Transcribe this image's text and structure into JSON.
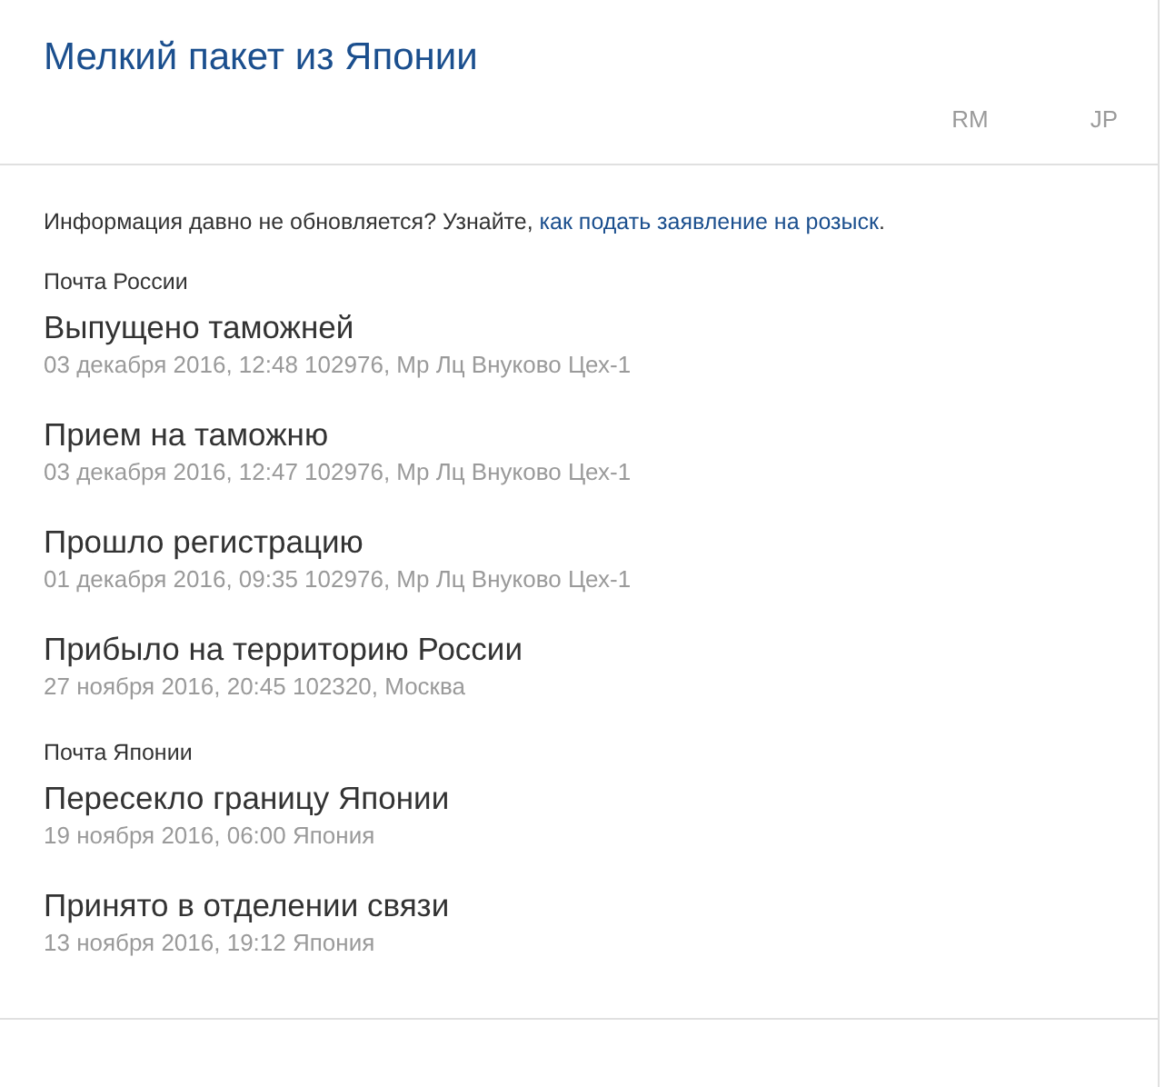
{
  "header": {
    "title": "Мелкий пакет из Японии",
    "codes": [
      "RM",
      "JP"
    ]
  },
  "notice": {
    "text": "Информация давно не обновляется? Узнайте, ",
    "link": "как подать заявление на розыск",
    "end": "."
  },
  "groups": [
    {
      "label": "Почта России",
      "events": [
        {
          "title": "Выпущено таможней",
          "detail": "03 декабря 2016, 12:48 102976, Мр Лц Внуково Цех-1"
        },
        {
          "title": "Прием на таможню",
          "detail": "03 декабря 2016, 12:47 102976, Мр Лц Внуково Цех-1"
        },
        {
          "title": "Прошло регистрацию",
          "detail": "01 декабря 2016, 09:35 102976, Мр Лц Внуково Цех-1"
        },
        {
          "title": "Прибыло на территорию России",
          "detail": "27 ноября 2016, 20:45 102320, Москва"
        }
      ]
    },
    {
      "label": "Почта Японии",
      "events": [
        {
          "title": "Пересекло границу Японии",
          "detail": "19 ноября 2016, 06:00 Япония"
        },
        {
          "title": "Принято в отделении связи",
          "detail": "13 ноября 2016, 19:12 Япония"
        }
      ]
    }
  ]
}
